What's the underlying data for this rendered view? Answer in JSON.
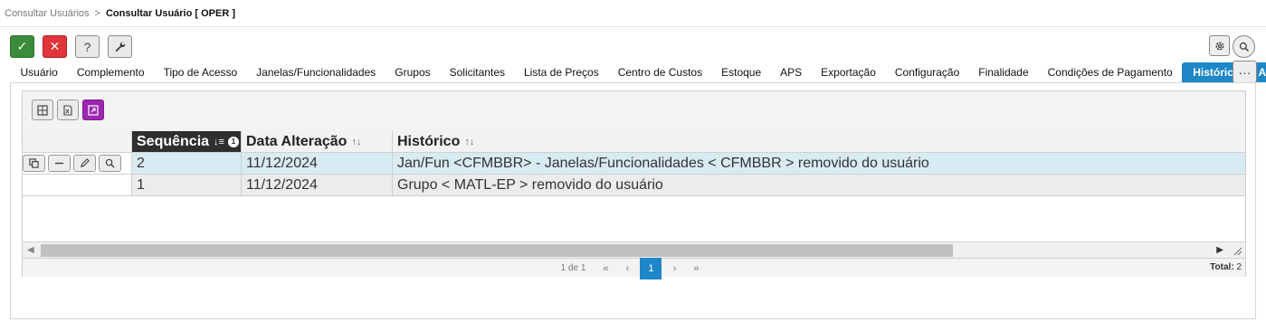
{
  "breadcrumb": {
    "parent": "Consultar Usuários",
    "separator": ">",
    "current": "Consultar Usuário [ OPER ]"
  },
  "toolbar": {
    "confirm": "✓",
    "cancel": "✕",
    "help": "?",
    "tools": "🔧"
  },
  "tabs": [
    "Usuário",
    "Complemento",
    "Tipo de Acesso",
    "Janelas/Funcionalidades",
    "Grupos",
    "Solicitantes",
    "Lista de Preços",
    "Centro de Custos",
    "Estoque",
    "APS",
    "Exportação",
    "Configuração",
    "Finalidade",
    "Condições de Pagamento",
    "Histórico de Alterações"
  ],
  "active_tab": "Histórico de Alterações",
  "more_label": "···",
  "table": {
    "columns": [
      {
        "label": "Sequência",
        "sort": "desc",
        "sort_order": "1"
      },
      {
        "label": "Data Alteração"
      },
      {
        "label": "Histórico"
      }
    ],
    "rows": [
      {
        "seq": "2",
        "date": "11/12/2024",
        "history": "Jan/Fun <CFMBBR> - Janelas/Funcionalidades < CFMBBR > removido do usuário",
        "selected": true
      },
      {
        "seq": "1",
        "date": "11/12/2024",
        "history": "Grupo < MATL-EP > removido do usuário",
        "selected": false
      }
    ]
  },
  "pager": {
    "info": "1 de 1",
    "current_page": "1",
    "first": "«",
    "prev": "‹",
    "next": "›",
    "last": "»",
    "total_label": "Total:",
    "total_value": "2"
  },
  "colors": {
    "accent": "#1e87c8",
    "ok": "#3a8c3a",
    "cancel": "#e0353a",
    "purple": "#9c27b0",
    "selected_row": "#d8ebf2",
    "sorted_header": "#2f2f2f"
  }
}
